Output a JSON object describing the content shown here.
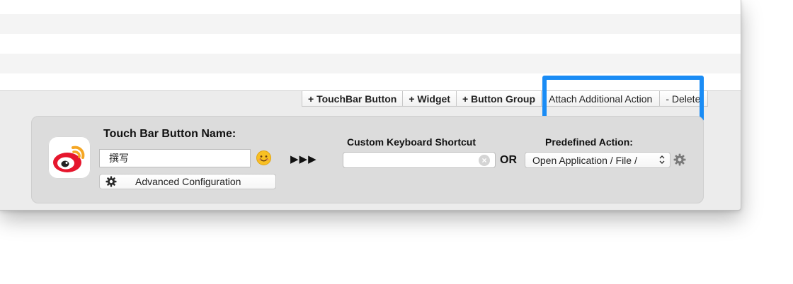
{
  "toolbar": {
    "add_touchbar_button": "+ TouchBar Button",
    "add_widget": "+ Widget",
    "add_button_group": "+ Button Group",
    "attach_additional_action": "Attach Additional Action",
    "delete": "- Delete"
  },
  "editor": {
    "name_label": "Touch Bar Button Name:",
    "name_value": "撰写",
    "emoji_icon": "smiley-emoji-icon",
    "advanced_label": "Advanced Configuration",
    "arrows": "▶▶▶",
    "shortcut_label": "Custom Keyboard Shortcut",
    "shortcut_value": "",
    "or_label": "OR",
    "predefined_label": "Predefined Action:",
    "predefined_value": "Open Application / File /"
  },
  "colors": {
    "highlight": "#1a8cf5",
    "weibo_red": "#e6162d",
    "weibo_orange": "#f5a623"
  }
}
